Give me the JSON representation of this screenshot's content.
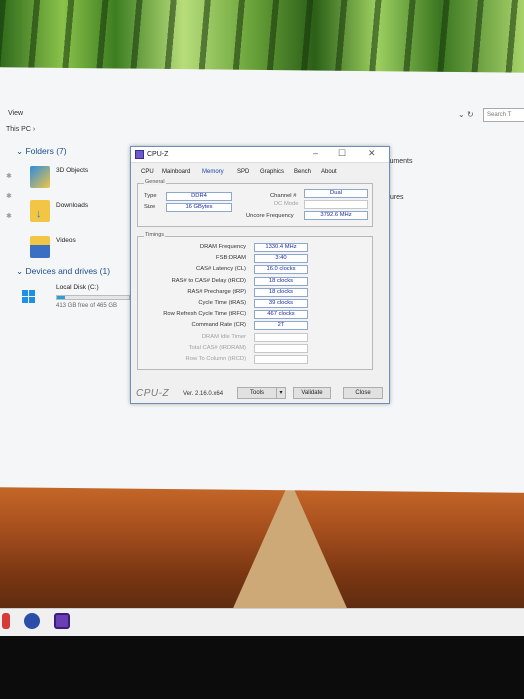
{
  "explorer": {
    "view_label": "View",
    "breadcrumb": "This PC ›",
    "search_placeholder": "Search T",
    "nav_chevron": "⌄",
    "nav_refresh": "↻",
    "folders_header": "Folders (7)",
    "folders": [
      {
        "label": "3D Objects"
      },
      {
        "label": "Downloads"
      },
      {
        "label": "Videos"
      }
    ],
    "right_items": [
      {
        "label": "cuments"
      },
      {
        "label": "tures"
      }
    ],
    "devices_header": "Devices and drives (1)",
    "drive": {
      "label": "Local Disk (C:)",
      "free": "413 GB free of 465 GB",
      "used_fraction": 0.11
    }
  },
  "cpuz": {
    "title": "CPU-Z",
    "window_buttons": {
      "minimize": "–",
      "maximize": "☐",
      "close": "✕"
    },
    "tabs": [
      {
        "label": "CPU"
      },
      {
        "label": "Mainboard"
      },
      {
        "label": "Memory",
        "active": true
      },
      {
        "label": "SPD"
      },
      {
        "label": "Graphics"
      },
      {
        "label": "Bench"
      },
      {
        "label": "About"
      }
    ],
    "general": {
      "title": "General",
      "type_label": "Type",
      "type_value": "DDR4",
      "size_label": "Size",
      "size_value": "16 GBytes",
      "channel_label": "Channel #",
      "channel_value": "Dual",
      "dc_mode_label": "DC Mode",
      "dc_mode_value": "",
      "uncore_label": "Uncore Frequency",
      "uncore_value": "3792.6 MHz"
    },
    "timings": {
      "title": "Timings",
      "rows": [
        {
          "label": "DRAM Frequency",
          "value": "1330.4 MHz"
        },
        {
          "label": "FSB:DRAM",
          "value": "3:40"
        },
        {
          "label": "CAS# Latency (CL)",
          "value": "16.0 clocks"
        },
        {
          "label": "RAS# to CAS# Delay (tRCD)",
          "value": "18 clocks"
        },
        {
          "label": "RAS# Precharge (tRP)",
          "value": "18 clocks"
        },
        {
          "label": "Cycle Time (tRAS)",
          "value": "39 clocks"
        },
        {
          "label": "Row Refresh Cycle Time (tRFC)",
          "value": "467 clocks"
        },
        {
          "label": "Command Rate (CR)",
          "value": "2T"
        },
        {
          "label": "DRAM Idle Timer",
          "value": "",
          "dim": true
        },
        {
          "label": "Total CAS# (tRDRAM)",
          "value": "",
          "dim": true
        },
        {
          "label": "Row To Column (tRCD)",
          "value": "",
          "dim": true
        }
      ]
    },
    "footer": {
      "logo": "CPU-Z",
      "version": "Ver. 2.16.0.x64",
      "tools_label": "Tools",
      "tools_arrow": "▾",
      "validate_label": "Validate",
      "close_label": "Close"
    }
  },
  "colors": {
    "accent": "#1a2aa0",
    "tab_active": "#1a3fb0",
    "folder_header": "#1c4e8c"
  }
}
